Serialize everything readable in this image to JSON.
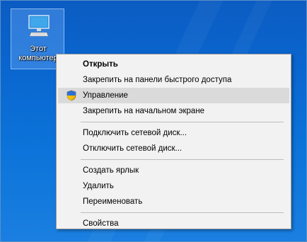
{
  "desktop": {
    "icon_label_line1": "Этот",
    "icon_label_line2": "компьютер"
  },
  "context_menu": {
    "groups": [
      [
        {
          "label": "Открыть",
          "bold": true
        },
        {
          "label": "Закрепить на панели быстрого доступа"
        },
        {
          "label": "Управление",
          "icon": "uac-shield-icon",
          "highlighted": true
        },
        {
          "label": "Закрепить на начальном экране"
        }
      ],
      [
        {
          "label": "Подключить сетевой диск..."
        },
        {
          "label": "Отключить сетевой диск..."
        }
      ],
      [
        {
          "label": "Создать ярлык"
        },
        {
          "label": "Удалить"
        },
        {
          "label": "Переименовать"
        }
      ],
      [
        {
          "label": "Свойства"
        }
      ]
    ]
  },
  "colors": {
    "desktop_bg": "#0a67d0",
    "menu_bg": "#f2f2f2",
    "menu_highlight": "#dadada"
  }
}
